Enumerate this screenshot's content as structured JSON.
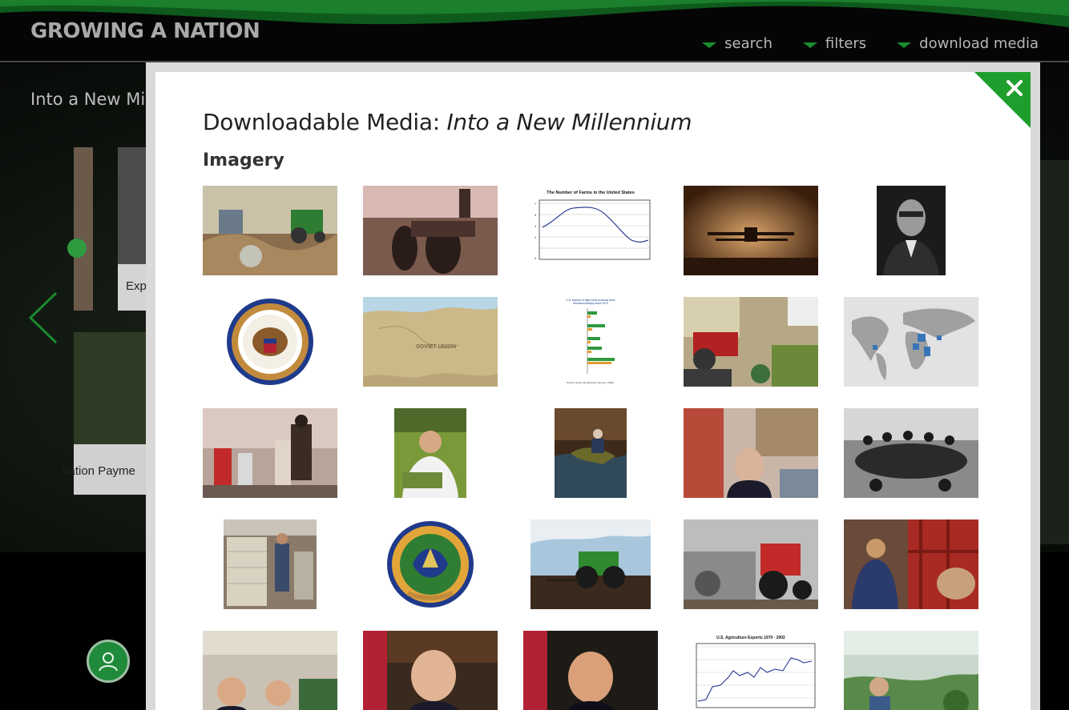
{
  "header": {
    "site_title": "GROWING A NATION",
    "nav": [
      {
        "label": "search"
      },
      {
        "label": "filters"
      },
      {
        "label": "download media"
      }
    ]
  },
  "background": {
    "page_title": "Into a New Mil",
    "card_label_1": "Exp",
    "card_label_2": "vation Payme"
  },
  "modal": {
    "title_prefix": "Downloadable Media: ",
    "title_italic": "Into a New Millennium",
    "section": "Imagery",
    "close_label": "×"
  },
  "colors": {
    "accent_green": "#1a8d2e",
    "close_green": "#1e9e2c",
    "modal_bg": "#ffffff"
  },
  "thumbnails": [
    {
      "name": "soviet-union-tractor-collage"
    },
    {
      "name": "farmer-on-tractor"
    },
    {
      "name": "farms-chart",
      "chart_title": "The Number of Farms in the United States"
    },
    {
      "name": "crop-duster-plane"
    },
    {
      "name": "portrait-official"
    },
    {
      "name": "congress-seal"
    },
    {
      "name": "soviet-union-map",
      "label": "SOVIET UNION"
    },
    {
      "name": "exports-bar-chart",
      "chart_title": "U.S. exports of high-value products have increased sharply since 1970",
      "source": "Source: Economic Research Service, USDA."
    },
    {
      "name": "oil-farm-collage"
    },
    {
      "name": "world-map-highlight"
    },
    {
      "name": "gas-station-farmer"
    },
    {
      "name": "scientist-plants"
    },
    {
      "name": "fisherman-stream"
    },
    {
      "name": "nixon-collage"
    },
    {
      "name": "cabinet-meeting"
    },
    {
      "name": "warehouse-worker"
    },
    {
      "name": "usda-seal"
    },
    {
      "name": "green-tractor-field"
    },
    {
      "name": "red-tractor-collage"
    },
    {
      "name": "cattle-vet"
    },
    {
      "name": "reagan-carter-collage"
    },
    {
      "name": "portrait-carter"
    },
    {
      "name": "portrait-reagan"
    },
    {
      "name": "exports-line-chart",
      "chart_title": "U.S. Agriculture Exports 1970 - 2002"
    },
    {
      "name": "farm-workers-collage"
    }
  ]
}
